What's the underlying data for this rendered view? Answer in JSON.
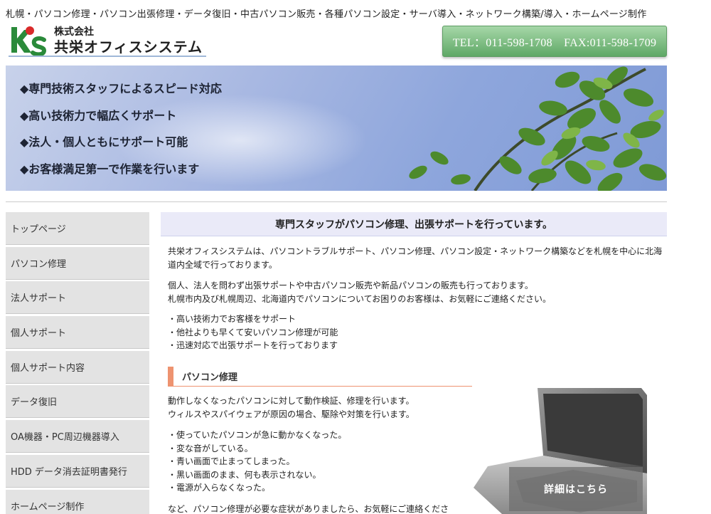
{
  "tagline": "札幌・パソコン修理・パソコン出張修理・データ復旧・中古パソコン販売・各種パソコン設定・サーバ導入・ネットワーク構築/導入・ホームページ制作",
  "logo": {
    "small": "株式会社",
    "main": "共栄オフィスシステム",
    "letters": "k's",
    "colors": {
      "k": "#2a8a3a",
      "dot": "#d92a2a",
      "s": "#2a8a3a"
    }
  },
  "contact": {
    "text": "TEL：011-598-1708　FAX:011-598-1709"
  },
  "banner": {
    "items": [
      "◆専門技術スタッフによるスピード対応",
      "◆高い技術力で幅広くサポート",
      "◆法人・個人ともにサポート可能",
      "◆お客様満足第一で作業を行います"
    ]
  },
  "sidebar": {
    "items": [
      {
        "label": "トップページ"
      },
      {
        "label": "パソコン修理"
      },
      {
        "label": "法人サポート"
      },
      {
        "label": "個人サポート"
      },
      {
        "label": "個人サポート内容"
      },
      {
        "label": "データ復旧"
      },
      {
        "label": "OA機器・PC周辺機器導入"
      },
      {
        "label": "HDD データ消去証明書発行"
      },
      {
        "label": "ホームページ制作"
      }
    ]
  },
  "main": {
    "heading": "専門スタッフがパソコン修理、出張サポートを行っています。",
    "intro": "共栄オフィスシステムは、パソコントラブルサポート、パソコン修理、パソコン設定・ネットワーク構築などを札幌を中心に北海道内全域で行っております。",
    "para2_line1": "個人、法人を問わず出張サポートや中古パソコン販売や新品パソコンの販売も行っております。",
    "para2_line2": "札幌市内及び札幌周辺、北海道内でパソコンについてお困りのお客様は、お気軽にご連絡ください。",
    "bullets": [
      "・高い技術力でお客様をサポート",
      "・他社よりも早くて安いパソコン修理が可能",
      "・迅速対応で出張サポートを行っております"
    ],
    "repair": {
      "title": "パソコン修理",
      "line1": "動作しなくなったパソコンに対して動作検証、修理を行います。",
      "line2": "ウィルスやスパイウェアが原因の場合、駆除や対策を行います。",
      "symptoms": [
        "・使っていたパソコンが急に動かなくなった。",
        "・変な音がしている。",
        "・青い画面で止まってしまった。",
        "・黒い画面のまま、何も表示されない。",
        "・電源が入らなくなった。"
      ],
      "footer": "など、パソコン修理が必要な症状がありましたら、お気軽にご連絡くださ",
      "detail_button": "詳細はこちら"
    }
  },
  "colors": {
    "accent_orange": "#ee9370",
    "header_bg": "#eaeaf8",
    "sidebar_bg": "#e3e3e3",
    "tel_green": "#5fa866"
  }
}
